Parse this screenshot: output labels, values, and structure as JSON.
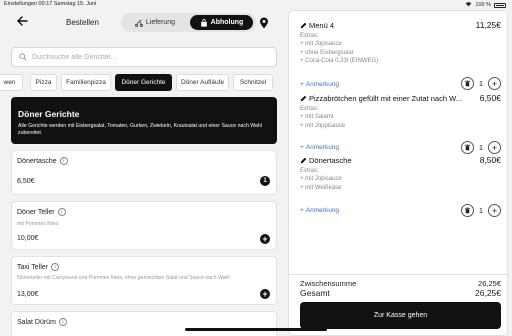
{
  "status_bar": {
    "left": "Einstellungen   00:17   Samstag 15. Juni",
    "battery": "100 %"
  },
  "header": {
    "title": "Bestellen",
    "mode_delivery": "Lieferung",
    "mode_pickup": "Abholung"
  },
  "search": {
    "placeholder": "Durchsuche alle Gerichte..."
  },
  "categories": [
    "wen",
    "Pizza",
    "Familienpizza",
    "Döner Gerichte",
    "Döner Aufläufe",
    "Schnitzel"
  ],
  "selected_category": "Döner Gerichte",
  "banner": {
    "title": "Döner Gerichte",
    "description": "Alle Gerichte werden mit Eisbergsalat, Tomaten, Gurken, Zwiebeln, Krautsalat und einer Sauce nach Wahl zubereitet."
  },
  "products": [
    {
      "name": "Dönertasche",
      "description": "",
      "price": "6,50€",
      "quantity": "1"
    },
    {
      "name": "Döner Teller",
      "description": "mit Pommes frites",
      "price": "10,00€"
    },
    {
      "name": "Taxi Teller",
      "description": "Dönerteller mit Currywurst und Pommes frites, ohne gemischten Salat und Sauce nach Wahl",
      "price": "13,00€"
    },
    {
      "name": "Salat Dürüm",
      "description": "",
      "price": ""
    }
  ],
  "cart": {
    "items": [
      {
        "name": "Menü 4",
        "price": "11,25€",
        "extras_label": "Extras:",
        "extras": [
          "+ mit Jopisauce",
          "+ ohne Eisbergsalat",
          "+ Coca-Cola 0,33l (EINWEG)"
        ],
        "note_label": "Anmerkung",
        "quantity": "1"
      },
      {
        "name": "Pizzabrötchen gefüllt mit einer Zutat nach W...",
        "price": "6,50€",
        "extras_label": "Extras:",
        "extras": [
          "+ mit Salami",
          "+ mit Joppisauce"
        ],
        "note_label": "Anmerkung",
        "quantity": "1"
      },
      {
        "name": "Dönertasche",
        "price": "8,50€",
        "extras_label": "Extras:",
        "extras": [
          "+ mit Jopisauce",
          "+ mit Weißkäse"
        ],
        "note_label": "Anmerkung",
        "quantity": "1"
      }
    ],
    "subtotal_label": "Zwischensumme",
    "subtotal_value": "26,25€",
    "total_label": "Gesamt",
    "total_value": "26,25€",
    "checkout_label": "Zur Kasse gehen"
  }
}
